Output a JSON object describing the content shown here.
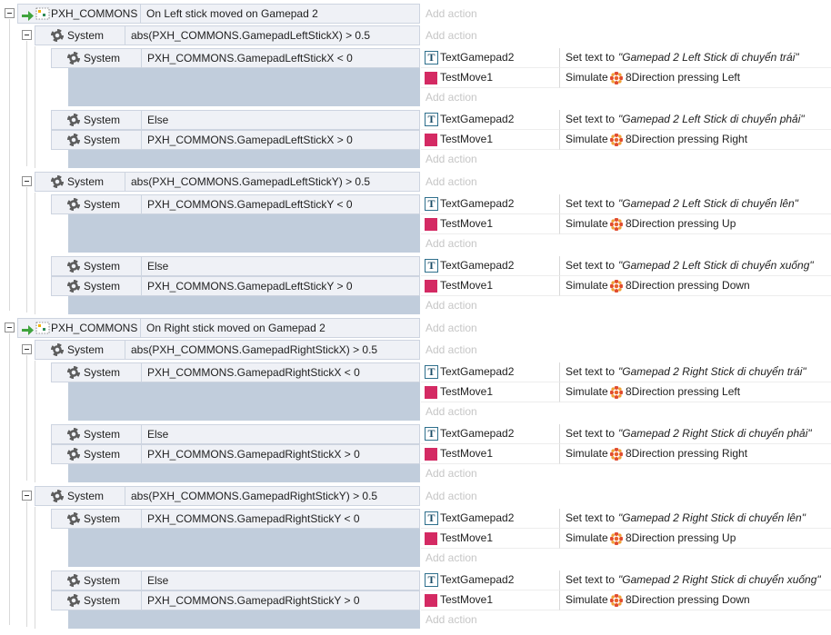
{
  "add_action_label": "Add action",
  "colors": {
    "condition_bg": "#eff1f6",
    "empty_action_fill": "#c1cddc",
    "sprite_color": "#d42a63",
    "add_action_text": "#c6c6c6"
  },
  "events": [
    {
      "extension": "PXH_COMMONS",
      "trigger": "On Left stick moved on Gamepad 2",
      "subevents": [
        {
          "object": "System",
          "condition": "abs(PXH_COMMONS.GamepadLeftStickX) > 0.5",
          "children": [
            {
              "conditions": [
                {
                  "object": "System",
                  "text": "PXH_COMMONS.GamepadLeftStickX < 0"
                }
              ],
              "actions": [
                {
                  "object": "TextGamepad2",
                  "object_icon": "text-object-icon",
                  "verb": "Set text to",
                  "value": "\"Gamepad 2 Left Stick di chuyển trái\""
                },
                {
                  "object": "TestMove1",
                  "object_icon": "sprite-icon",
                  "verb": "Simulate",
                  "behavior_icon": "8direction-icon",
                  "value": "8Direction pressing Left"
                }
              ]
            },
            {
              "conditions": [
                {
                  "object": "System",
                  "text": "Else"
                },
                {
                  "object": "System",
                  "text": "PXH_COMMONS.GamepadLeftStickX > 0"
                }
              ],
              "actions": [
                {
                  "object": "TextGamepad2",
                  "object_icon": "text-object-icon",
                  "verb": "Set text to",
                  "value": "\"Gamepad 2 Left Stick di chuyển phải\""
                },
                {
                  "object": "TestMove1",
                  "object_icon": "sprite-icon",
                  "verb": "Simulate",
                  "behavior_icon": "8direction-icon",
                  "value": "8Direction pressing Right"
                }
              ]
            }
          ]
        },
        {
          "object": "System",
          "condition": "abs(PXH_COMMONS.GamepadLeftStickY) > 0.5",
          "children": [
            {
              "conditions": [
                {
                  "object": "System",
                  "text": "PXH_COMMONS.GamepadLeftStickY < 0"
                }
              ],
              "actions": [
                {
                  "object": "TextGamepad2",
                  "object_icon": "text-object-icon",
                  "verb": "Set text to",
                  "value": "\"Gamepad 2 Left Stick di chuyển lên\""
                },
                {
                  "object": "TestMove1",
                  "object_icon": "sprite-icon",
                  "verb": "Simulate",
                  "behavior_icon": "8direction-icon",
                  "value": "8Direction pressing Up"
                }
              ]
            },
            {
              "conditions": [
                {
                  "object": "System",
                  "text": "Else"
                },
                {
                  "object": "System",
                  "text": "PXH_COMMONS.GamepadLeftStickY > 0"
                }
              ],
              "actions": [
                {
                  "object": "TextGamepad2",
                  "object_icon": "text-object-icon",
                  "verb": "Set text to",
                  "value": "\"Gamepad 2 Left Stick di chuyển xuống\""
                },
                {
                  "object": "TestMove1",
                  "object_icon": "sprite-icon",
                  "verb": "Simulate",
                  "behavior_icon": "8direction-icon",
                  "value": "8Direction pressing Down"
                }
              ]
            }
          ]
        }
      ]
    },
    {
      "extension": "PXH_COMMONS",
      "trigger": "On Right stick moved on Gamepad 2",
      "subevents": [
        {
          "object": "System",
          "condition": "abs(PXH_COMMONS.GamepadRightStickX) > 0.5",
          "children": [
            {
              "conditions": [
                {
                  "object": "System",
                  "text": "PXH_COMMONS.GamepadRightStickX < 0"
                }
              ],
              "actions": [
                {
                  "object": "TextGamepad2",
                  "object_icon": "text-object-icon",
                  "verb": "Set text to",
                  "value": "\"Gamepad 2 Right Stick di chuyển trái\""
                },
                {
                  "object": "TestMove1",
                  "object_icon": "sprite-icon",
                  "verb": "Simulate",
                  "behavior_icon": "8direction-icon",
                  "value": "8Direction pressing Left"
                }
              ]
            },
            {
              "conditions": [
                {
                  "object": "System",
                  "text": "Else"
                },
                {
                  "object": "System",
                  "text": "PXH_COMMONS.GamepadRightStickX > 0"
                }
              ],
              "actions": [
                {
                  "object": "TextGamepad2",
                  "object_icon": "text-object-icon",
                  "verb": "Set text to",
                  "value": "\"Gamepad 2 Right Stick di chuyển phải\""
                },
                {
                  "object": "TestMove1",
                  "object_icon": "sprite-icon",
                  "verb": "Simulate",
                  "behavior_icon": "8direction-icon",
                  "value": "8Direction pressing Right"
                }
              ]
            }
          ]
        },
        {
          "object": "System",
          "condition": "abs(PXH_COMMONS.GamepadRightStickY) > 0.5",
          "children": [
            {
              "conditions": [
                {
                  "object": "System",
                  "text": "PXH_COMMONS.GamepadRightStickY < 0"
                }
              ],
              "actions": [
                {
                  "object": "TextGamepad2",
                  "object_icon": "text-object-icon",
                  "verb": "Set text to",
                  "value": "\"Gamepad 2 Right Stick di chuyển lên\""
                },
                {
                  "object": "TestMove1",
                  "object_icon": "sprite-icon",
                  "verb": "Simulate",
                  "behavior_icon": "8direction-icon",
                  "value": "8Direction pressing Up"
                }
              ]
            },
            {
              "conditions": [
                {
                  "object": "System",
                  "text": "Else"
                },
                {
                  "object": "System",
                  "text": "PXH_COMMONS.GamepadRightStickY > 0"
                }
              ],
              "actions": [
                {
                  "object": "TextGamepad2",
                  "object_icon": "text-object-icon",
                  "verb": "Set text to",
                  "value": "\"Gamepad 2 Right Stick di chuyển xuống\""
                },
                {
                  "object": "TestMove1",
                  "object_icon": "sprite-icon",
                  "verb": "Simulate",
                  "behavior_icon": "8direction-icon",
                  "value": "8Direction pressing Down"
                }
              ]
            }
          ]
        }
      ]
    }
  ]
}
